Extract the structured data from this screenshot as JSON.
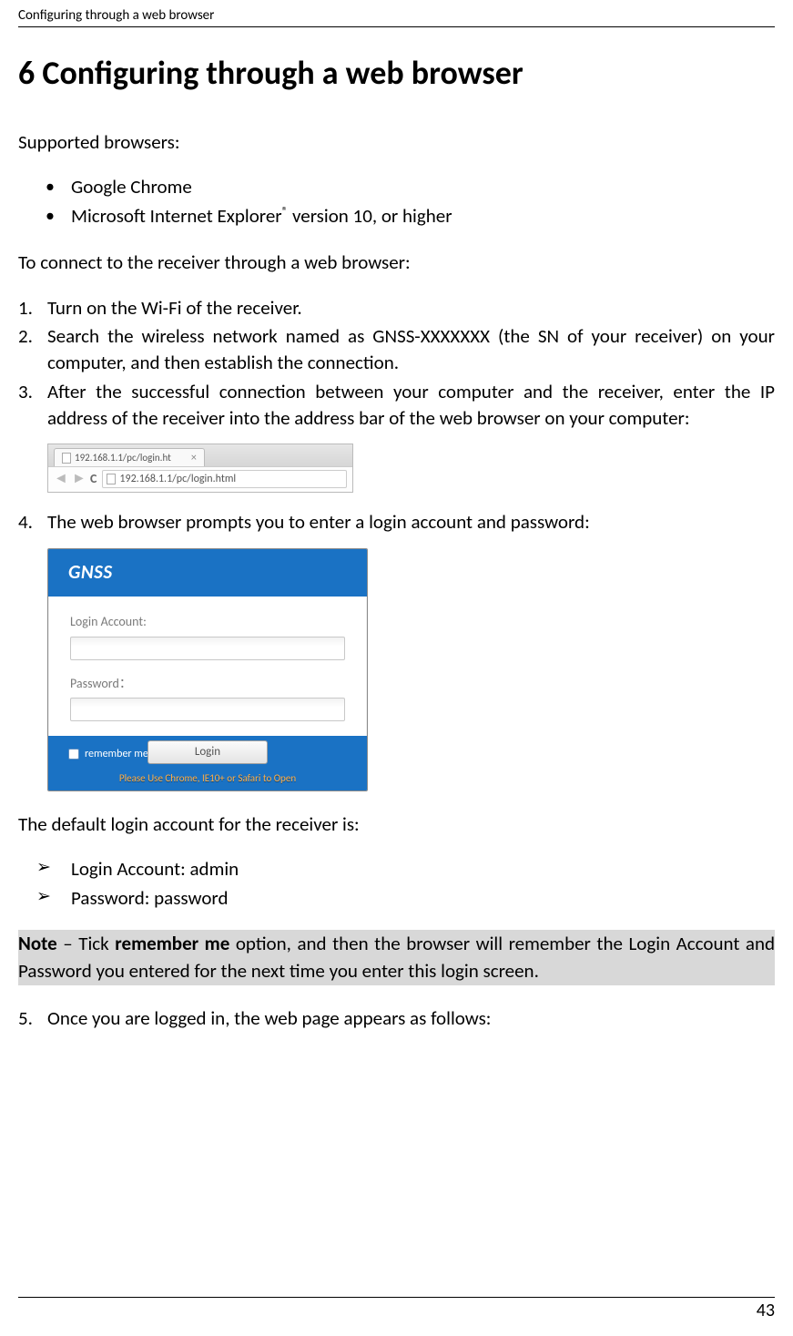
{
  "header": {
    "section_title": "Configuring through a web browser"
  },
  "h1": "6  Configuring through a web browser",
  "p_supported": "Supported browsers:",
  "browsers": {
    "item1": "Google Chrome",
    "item2_pre": "Microsoft Internet Explorer",
    "item2_sup": "®",
    "item2_post": "  version 10, or higher"
  },
  "p_connect": "To connect to the receiver through a web browser:",
  "steps": {
    "s1": "Turn on the Wi-Fi of the receiver.",
    "s2": "Search the wireless network named as GNSS-XXXXXXX (the SN of your receiver) on your computer, and then establish the connection.",
    "s3": "After the successful connection between your computer and the receiver, enter the IP address of the receiver into the address bar of the web browser on your computer:",
    "s4": "The web browser prompts you to enter a login account and password:",
    "s5": "Once you are logged in, the web page appears as follows:"
  },
  "screenshot1": {
    "tab_title": "192.168.1.1/pc/login.ht",
    "address": "192.168.1.1/pc/login.html"
  },
  "screenshot2": {
    "brand": "GNSS",
    "label_account": "Login Account:",
    "label_password": "Password：",
    "remember": "remember me",
    "login_btn": "Login",
    "footer_note": "Please Use Chrome, IE10+ or Safari to Open"
  },
  "p_default": "The default login account for the receiver is:",
  "defaults": {
    "d1": "Login Account: admin",
    "d2": "Password: password"
  },
  "note": {
    "prefix_bold": "Note",
    "dash": " – Tick ",
    "bold2": "remember me",
    "rest": " option, and then the browser will remember the Login Account and Password you entered for the next time you enter this login screen."
  },
  "page_number": "43"
}
